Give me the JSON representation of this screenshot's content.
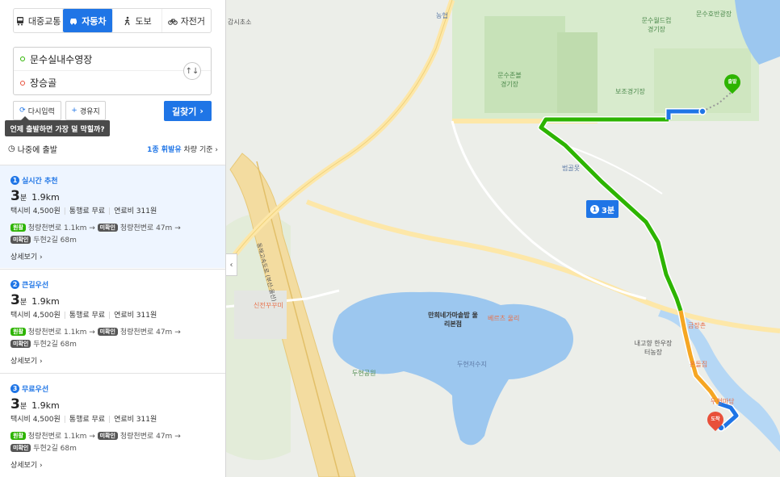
{
  "modes": [
    {
      "label": "대중교통",
      "icon": "bus-icon"
    },
    {
      "label": "자동차",
      "icon": "car-icon"
    },
    {
      "label": "도보",
      "icon": "walk-icon"
    },
    {
      "label": "자전거",
      "icon": "bike-icon"
    }
  ],
  "route_input": {
    "origin": "문수실내수영장",
    "destination": "장승골",
    "swap": "↑↓"
  },
  "actions": {
    "reset": "다시입력",
    "via": "경유지",
    "search": "길찾기"
  },
  "tooltip": "언제 출발하면 가장 덜 막힐까?",
  "depart": {
    "later": "나중에 출발",
    "fuel_link": "1종 휘발유",
    "fuel_suffix": "차량 기준"
  },
  "routes": [
    {
      "num": "1",
      "title": "실시간 추천",
      "minutes": "3",
      "unit": "분",
      "distance": "1.9km",
      "taxi": "택시비 4,500원",
      "toll": "통행료 무료",
      "fuel": "연료비 311원",
      "badge1": "원활",
      "road1": "청량천변로",
      "dist1": "1.1km",
      "badge2": "미확인",
      "road2": "청량천변로",
      "dist2": "47m",
      "badge3": "미확인",
      "road3": "두현2길",
      "dist3": "68m",
      "more": "상세보기"
    },
    {
      "num": "2",
      "title": "큰길우선",
      "minutes": "3",
      "unit": "분",
      "distance": "1.9km",
      "taxi": "택시비 4,500원",
      "toll": "통행료 무료",
      "fuel": "연료비 311원",
      "badge1": "원활",
      "road1": "청량천변로",
      "dist1": "1.1km",
      "badge2": "미확인",
      "road2": "청량천변로",
      "dist2": "47m",
      "badge3": "미확인",
      "road3": "두현2길",
      "dist3": "68m",
      "more": "상세보기"
    },
    {
      "num": "3",
      "title": "무료우선",
      "minutes": "3",
      "unit": "분",
      "distance": "1.9km",
      "taxi": "택시비 4,500원",
      "toll": "통행료 무료",
      "fuel": "연료비 311원",
      "badge1": "원활",
      "road1": "청량천변로",
      "dist1": "1.1km",
      "badge2": "미확인",
      "road2": "청량천변로",
      "dist2": "47m",
      "badge3": "미확인",
      "road3": "두현2길",
      "dist3": "68m",
      "more": "상세보기"
    }
  ],
  "map": {
    "labels": {
      "nonghyup": "농협",
      "gamsiso": "감시초소",
      "worldcup": "문수월드컵 경기장",
      "lake_park": "문수호반광장",
      "soccer": "문수축구 경기장",
      "aux": "보조경기장",
      "sports": "문수존볼 경기장",
      "beomgol": "범골못",
      "highway": "동해고속도로 (부산-울산)",
      "sinjeon": "신전꾸꾸미",
      "restaurant": "만희네가마솥밥 울리본점",
      "beltz": "베르츠 울리",
      "park": "두현공원",
      "reservoir": "두현저수지",
      "nerhyang": "내고향 한우장터농장",
      "chon": "금장촌",
      "jip": "온돌집",
      "ttang": "두현마당"
    },
    "start_pin": "출발",
    "end_pin": "도착",
    "time_badge_num": "1",
    "time_badge": "3분",
    "route_colors": {
      "smooth": "#2db400",
      "slow": "#f5a623",
      "unknown": "#1f75e6"
    }
  }
}
